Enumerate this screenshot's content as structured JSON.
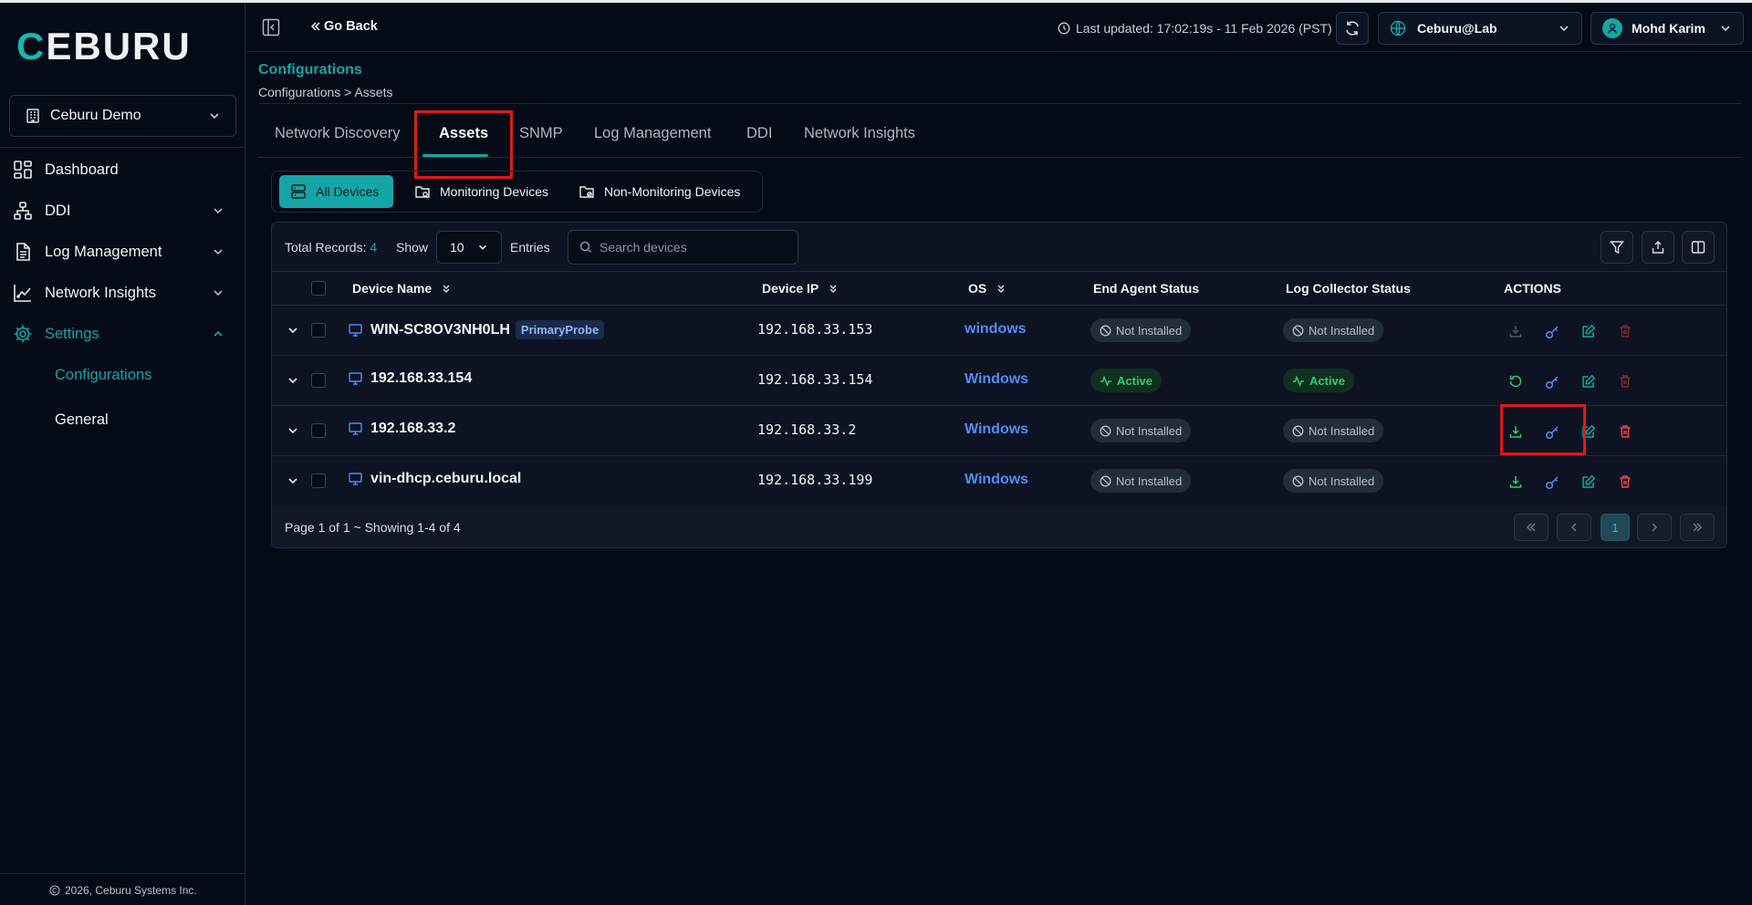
{
  "sidebar": {
    "logo_text": "CEBURU",
    "org": "Ceburu Demo",
    "nav": [
      {
        "label": "Dashboard",
        "icon": "dashboard-icon"
      },
      {
        "label": "DDI",
        "icon": "network-icon"
      },
      {
        "label": "Log Management",
        "icon": "document-icon"
      },
      {
        "label": "Network Insights",
        "icon": "chart-icon"
      },
      {
        "label": "Settings",
        "icon": "gear-icon"
      }
    ],
    "settings_sub": [
      "Configurations",
      "General"
    ],
    "copyright": "2026, Ceburu Systems Inc."
  },
  "header": {
    "go_back": "Go Back",
    "last_updated": "Last updated: 17:02:19s - 11 Feb 2026 (PST)",
    "environment": "Ceburu@Lab",
    "user": "Mohd Karim"
  },
  "page": {
    "title": "Configurations",
    "breadcrumb": "Configurations > Assets"
  },
  "tabs": [
    "Network Discovery",
    "Assets",
    "SNMP",
    "Log Management",
    "DDI",
    "Network Insights"
  ],
  "filters": [
    "All Devices",
    "Monitoring Devices",
    "Non-Monitoring Devices"
  ],
  "toolbar": {
    "total_label": "Total Records:",
    "total_value": "4",
    "show_label": "Show",
    "page_size": "10",
    "entries_label": "Entries",
    "search_placeholder": "Search devices"
  },
  "columns": [
    "Device Name",
    "Device IP",
    "OS",
    "End Agent Status",
    "Log Collector Status",
    "ACTIONS"
  ],
  "rows": [
    {
      "name": "WIN-SC8OV3NH0LH",
      "tag": "PrimaryProbe",
      "ip": "192.168.33.153",
      "os": "windows",
      "agent": "Not Installed",
      "collector": "Not Installed"
    },
    {
      "name": "192.168.33.154",
      "tag": "",
      "ip": "192.168.33.154",
      "os": "Windows",
      "agent": "Active",
      "collector": "Active"
    },
    {
      "name": "192.168.33.2",
      "tag": "",
      "ip": "192.168.33.2",
      "os": "Windows",
      "agent": "Not Installed",
      "collector": "Not Installed"
    },
    {
      "name": "vin-dhcp.ceburu.local",
      "tag": "",
      "ip": "192.168.33.199",
      "os": "Windows",
      "agent": "Not Installed",
      "collector": "Not Installed"
    }
  ],
  "pagination": {
    "info": "Page 1 of 1 ~ Showing 1-4 of 4",
    "current_page": "1"
  },
  "colors": {
    "accent": "#14a6a6",
    "active_green": "#2ecc71",
    "os_blue": "#4f8df7",
    "delete_red": "#e5484d",
    "highlight": "#e01818"
  }
}
